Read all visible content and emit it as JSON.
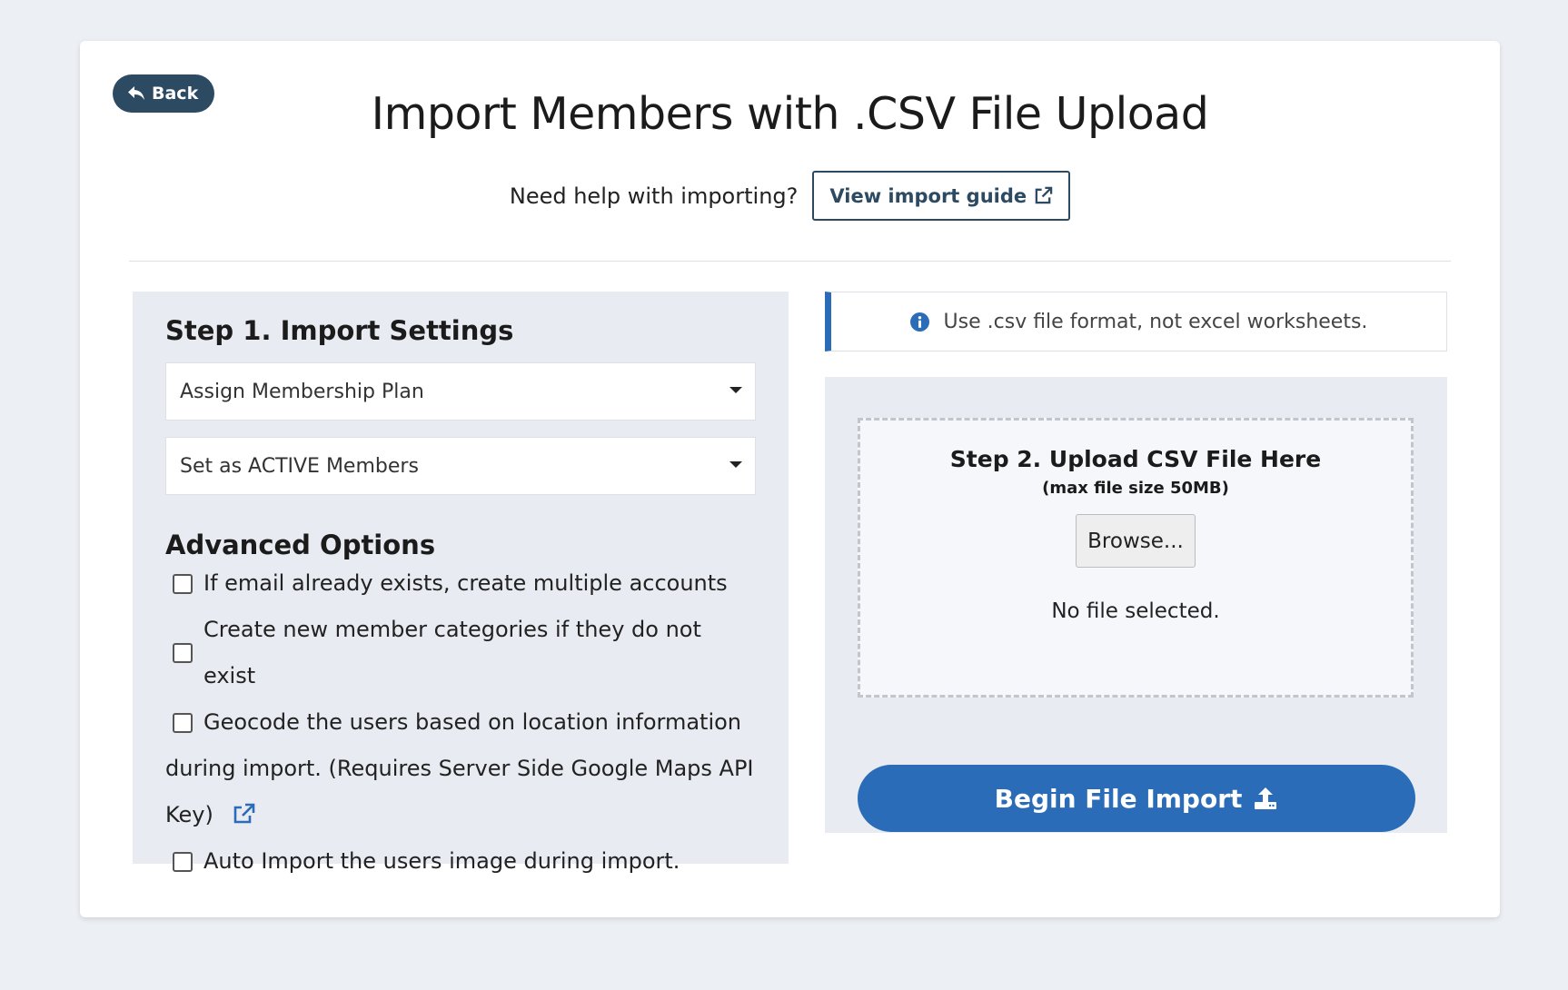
{
  "header": {
    "back_label": "Back",
    "title": "Import Members with .CSV File Upload",
    "help_text": "Need help with importing?",
    "guide_label": "View import guide"
  },
  "settings": {
    "step_title": "Step 1. Import Settings",
    "plan_select": "Assign Membership Plan",
    "status_select": "Set as ACTIVE Members"
  },
  "advanced": {
    "title": "Advanced Options",
    "options": [
      {
        "label": "If email already exists, create multiple accounts",
        "checked": false
      },
      {
        "label": "Create new member categories if they do not exist",
        "checked": false
      },
      {
        "label_line1": "Geocode the users based on location information",
        "label_line2": "during import. (Requires Server Side Google Maps API",
        "label_line3": "Key)",
        "checked": false
      },
      {
        "label": "Auto Import the users image during import.",
        "checked": false
      }
    ]
  },
  "upload": {
    "info_text": "Use .csv file format, not excel worksheets.",
    "step_title": "Step 2. Upload CSV File Here",
    "max_size": "(max file size 50MB)",
    "browse_label": "Browse...",
    "file_status": "No file selected.",
    "begin_label": "Begin File Import"
  },
  "colors": {
    "primary_blue": "#2a6cb7",
    "dark_navy": "#2d4a63",
    "panel_bg": "#e8ebf1"
  }
}
